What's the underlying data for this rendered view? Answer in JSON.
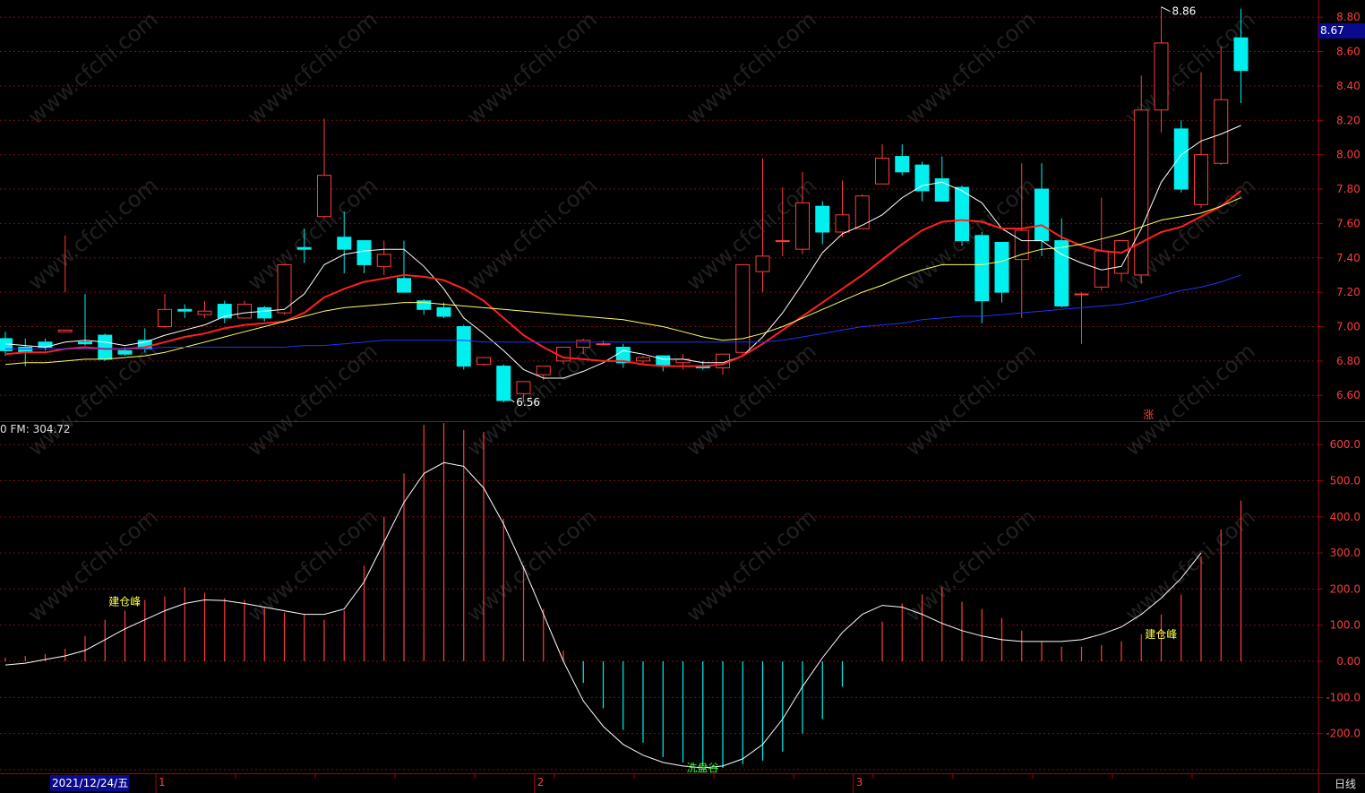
{
  "chart_data": [
    {
      "type": "candlestick",
      "pane": "price",
      "ylim": [
        6.45,
        8.9
      ],
      "y_ticks": [
        "8.80",
        "8.60",
        "8.40",
        "8.20",
        "8.00",
        "7.80",
        "7.60",
        "7.40",
        "7.20",
        "7.00",
        "6.80",
        "6.60"
      ],
      "grid": true,
      "current_price": "8.67",
      "high_label": "8.86",
      "low_label": "6.56",
      "limit_up_label": "涨",
      "candles": [
        [
          6.93,
          6.97,
          6.86,
          6.83
        ],
        [
          6.88,
          6.93,
          6.85,
          6.77
        ],
        [
          6.91,
          6.93,
          6.88,
          6.86
        ],
        [
          6.97,
          7.53,
          6.98,
          7.2
        ],
        [
          6.91,
          7.19,
          6.9,
          6.89
        ],
        [
          6.95,
          6.96,
          6.81,
          6.8
        ],
        [
          6.86,
          6.88,
          6.84,
          6.83
        ],
        [
          6.92,
          6.99,
          6.87,
          6.85
        ],
        [
          7.0,
          7.19,
          7.1,
          6.99
        ],
        [
          7.1,
          7.13,
          7.09,
          7.05
        ],
        [
          7.07,
          7.15,
          7.09,
          7.05
        ],
        [
          7.13,
          7.15,
          7.05,
          7.02
        ],
        [
          7.05,
          7.15,
          7.13,
          7.05
        ],
        [
          7.11,
          7.12,
          7.05,
          7.03
        ],
        [
          7.08,
          7.36,
          7.36,
          7.07
        ],
        [
          7.46,
          7.57,
          7.45,
          7.37
        ],
        [
          7.64,
          8.21,
          7.88,
          7.63
        ],
        [
          7.52,
          7.67,
          7.45,
          7.31
        ],
        [
          7.5,
          7.5,
          7.36,
          7.31
        ],
        [
          7.35,
          7.5,
          7.42,
          7.3
        ],
        [
          7.28,
          7.5,
          7.2,
          7.2
        ],
        [
          7.15,
          7.16,
          7.1,
          7.07
        ],
        [
          7.11,
          7.14,
          7.06,
          7.05
        ],
        [
          7.0,
          7.01,
          6.77,
          6.75
        ],
        [
          6.78,
          6.81,
          6.82,
          6.77
        ],
        [
          6.77,
          6.78,
          6.57,
          6.56
        ],
        [
          6.61,
          6.64,
          6.68,
          6.56
        ],
        [
          6.72,
          6.77,
          6.77,
          6.69
        ],
        [
          6.8,
          6.82,
          6.88,
          6.78
        ],
        [
          6.88,
          6.93,
          6.92,
          6.84
        ],
        [
          6.9,
          6.92,
          6.9,
          6.89
        ],
        [
          6.88,
          6.9,
          6.79,
          6.76
        ],
        [
          6.8,
          6.83,
          6.82,
          6.78
        ],
        [
          6.83,
          6.83,
          6.77,
          6.74
        ],
        [
          6.79,
          6.84,
          6.81,
          6.75
        ],
        [
          6.77,
          6.8,
          6.76,
          6.75
        ],
        [
          6.76,
          6.84,
          6.84,
          6.72
        ],
        [
          6.85,
          6.99,
          7.36,
          6.83
        ],
        [
          7.32,
          7.98,
          7.41,
          7.2
        ],
        [
          7.5,
          7.81,
          7.5,
          7.41
        ],
        [
          7.45,
          7.9,
          7.72,
          7.42
        ],
        [
          7.7,
          7.73,
          7.55,
          7.48
        ],
        [
          7.55,
          7.85,
          7.65,
          7.52
        ],
        [
          7.57,
          7.77,
          7.76,
          7.58
        ],
        [
          7.83,
          8.06,
          7.98,
          7.83
        ],
        [
          7.99,
          8.06,
          7.9,
          7.88
        ],
        [
          7.94,
          7.96,
          7.79,
          7.73
        ],
        [
          7.86,
          7.99,
          7.73,
          7.73
        ],
        [
          7.81,
          7.82,
          7.5,
          7.47
        ],
        [
          7.53,
          7.55,
          7.15,
          7.02
        ],
        [
          7.49,
          7.49,
          7.2,
          7.14
        ],
        [
          7.39,
          7.95,
          7.56,
          7.05
        ],
        [
          7.8,
          7.95,
          7.5,
          7.41
        ],
        [
          7.5,
          7.63,
          7.12,
          7.11
        ],
        [
          7.19,
          7.2,
          7.19,
          6.9
        ],
        [
          7.23,
          7.75,
          7.44,
          7.21
        ],
        [
          7.31,
          7.49,
          7.5,
          7.26
        ],
        [
          7.3,
          8.46,
          8.26,
          7.25
        ],
        [
          8.26,
          8.86,
          8.65,
          8.13
        ],
        [
          8.15,
          8.2,
          7.8,
          7.78
        ],
        [
          7.71,
          8.48,
          8.0,
          7.69
        ],
        [
          7.95,
          8.63,
          8.32,
          7.94
        ],
        [
          8.68,
          8.85,
          8.49,
          8.3
        ]
      ],
      "moving_averages": [
        {
          "color": "#ffffff",
          "values": [
            6.9,
            6.89,
            6.88,
            6.91,
            6.92,
            6.91,
            6.89,
            6.91,
            6.95,
            6.98,
            7.01,
            7.06,
            7.08,
            7.09,
            7.1,
            7.19,
            7.36,
            7.42,
            7.44,
            7.45,
            7.45,
            7.35,
            7.22,
            7.05,
            6.96,
            6.86,
            6.75,
            6.7,
            6.7,
            6.74,
            6.79,
            6.86,
            6.84,
            6.81,
            6.81,
            6.79,
            6.79,
            6.83,
            6.94,
            7.08,
            7.25,
            7.43,
            7.54,
            7.59,
            7.65,
            7.75,
            7.82,
            7.84,
            7.79,
            7.72,
            7.57,
            7.5,
            7.5,
            7.42,
            7.37,
            7.33,
            7.35,
            7.57,
            7.84,
            8.0,
            8.08,
            8.12,
            8.17
          ]
        },
        {
          "color": "#ff2020",
          "values": [
            6.84,
            6.85,
            6.85,
            6.87,
            6.88,
            6.87,
            6.87,
            6.88,
            6.91,
            6.94,
            6.96,
            6.99,
            7.01,
            7.02,
            7.03,
            7.08,
            7.17,
            7.22,
            7.26,
            7.28,
            7.3,
            7.29,
            7.27,
            7.22,
            7.15,
            7.05,
            6.95,
            6.88,
            6.82,
            6.81,
            6.8,
            6.8,
            6.78,
            6.77,
            6.77,
            6.77,
            6.78,
            6.83,
            6.9,
            6.98,
            7.06,
            7.14,
            7.22,
            7.3,
            7.39,
            7.48,
            7.56,
            7.61,
            7.62,
            7.61,
            7.57,
            7.57,
            7.59,
            7.52,
            7.47,
            7.44,
            7.43,
            7.49,
            7.55,
            7.58,
            7.64,
            7.7,
            7.79
          ]
        },
        {
          "color": "#ffff60",
          "values": [
            6.78,
            6.79,
            6.79,
            6.8,
            6.81,
            6.81,
            6.82,
            6.83,
            6.85,
            6.88,
            6.91,
            6.94,
            6.97,
            7.0,
            7.03,
            7.06,
            7.09,
            7.11,
            7.12,
            7.13,
            7.14,
            7.14,
            7.13,
            7.12,
            7.11,
            7.1,
            7.09,
            7.08,
            7.07,
            7.06,
            7.05,
            7.04,
            7.02,
            7.0,
            6.97,
            6.94,
            6.92,
            6.93,
            6.96,
            7.0,
            7.05,
            7.1,
            7.15,
            7.2,
            7.24,
            7.29,
            7.33,
            7.36,
            7.36,
            7.36,
            7.38,
            7.42,
            7.45,
            7.46,
            7.48,
            7.51,
            7.54,
            7.58,
            7.62,
            7.64,
            7.66,
            7.7,
            7.75
          ]
        },
        {
          "color": "#2030ff",
          "values": [
            6.87,
            6.87,
            6.87,
            6.87,
            6.87,
            6.87,
            6.87,
            6.87,
            6.88,
            6.88,
            6.88,
            6.88,
            6.88,
            6.88,
            6.88,
            6.89,
            6.89,
            6.9,
            6.91,
            6.92,
            6.92,
            6.92,
            6.92,
            6.92,
            6.91,
            6.91,
            6.91,
            6.91,
            6.91,
            6.91,
            6.91,
            6.91,
            6.91,
            6.91,
            6.91,
            6.91,
            6.91,
            6.91,
            6.91,
            6.92,
            6.94,
            6.96,
            6.98,
            7.0,
            7.01,
            7.02,
            7.04,
            7.05,
            7.06,
            7.06,
            7.07,
            7.08,
            7.09,
            7.1,
            7.11,
            7.12,
            7.13,
            7.15,
            7.18,
            7.21,
            7.23,
            7.26,
            7.3
          ]
        }
      ]
    },
    {
      "type": "bar",
      "pane": "indicator",
      "fm_label": "0  FM: 304.72",
      "ylim": [
        -310,
        660
      ],
      "y_ticks": [
        "600.0",
        "500.0",
        "400.0",
        "300.0",
        "200.0",
        "100.0",
        "0.00",
        "-100.0",
        "-200.0"
      ],
      "grid": true,
      "bar_values": [
        10,
        15,
        20,
        35,
        70,
        115,
        140,
        170,
        180,
        205,
        190,
        175,
        170,
        150,
        135,
        130,
        115,
        140,
        265,
        400,
        520,
        655,
        660,
        640,
        635,
        395,
        265,
        145,
        30,
        -60,
        -130,
        -190,
        -225,
        -265,
        -280,
        -290,
        -295,
        -285,
        -275,
        -250,
        -200,
        -160,
        -70,
        0,
        110,
        160,
        185,
        205,
        165,
        145,
        120,
        85,
        55,
        40,
        40,
        45,
        55,
        75,
        130,
        185,
        290,
        365,
        445
      ],
      "line_values": [
        -10,
        -5,
        5,
        15,
        30,
        60,
        90,
        115,
        140,
        160,
        170,
        168,
        160,
        150,
        140,
        130,
        130,
        145,
        220,
        330,
        440,
        520,
        550,
        540,
        480,
        380,
        260,
        130,
        0,
        -110,
        -180,
        -230,
        -260,
        -280,
        -290,
        -295,
        -290,
        -270,
        -230,
        -160,
        -70,
        10,
        80,
        130,
        155,
        150,
        130,
        105,
        85,
        70,
        60,
        55,
        55,
        55,
        60,
        75,
        95,
        130,
        175,
        230,
        300
      ],
      "annotations": [
        {
          "text": "建仓峰",
          "color": "#ffff40",
          "bar_index": 5,
          "value": 155
        },
        {
          "text": "洗盘谷",
          "color": "#40ff40",
          "bar_index": 34,
          "value": -305
        },
        {
          "text": "建仓峰",
          "color": "#ffff40",
          "bar_index": 57,
          "value": 65
        }
      ]
    }
  ],
  "x_axis": {
    "date_label": "2021/12/24/五",
    "month_marks": [
      {
        "label": "1",
        "bar_index": 8
      },
      {
        "label": "2",
        "bar_index": 27
      },
      {
        "label": "3",
        "bar_index": 43
      }
    ],
    "period_label": "日线"
  },
  "watermark": "www.cfchi.com",
  "colors": {
    "up": "#ff3c3c",
    "down": "#00f0f0",
    "grid": "#7a1010",
    "frame": "#b00000",
    "axis_text": "#ff3c3c",
    "badge_bg": "#0a0a8c",
    "ann_peak": "#ffff40",
    "ann_valley": "#40ff40"
  }
}
